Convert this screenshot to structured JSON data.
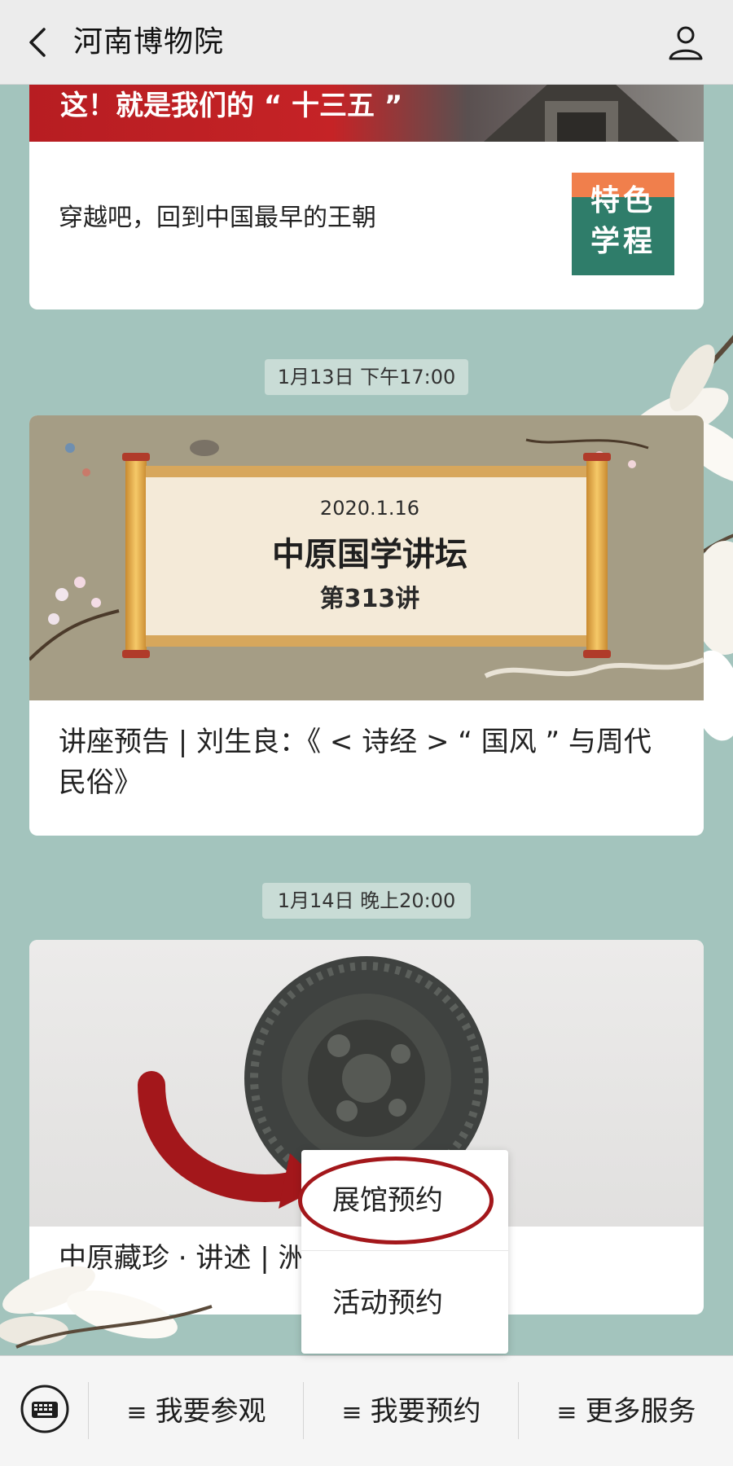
{
  "header": {
    "title": "河南博物院",
    "back_icon": "chevron-left-icon",
    "profile_icon": "person-icon"
  },
  "feed": {
    "card1": {
      "banner_text": "这！就是我们的 “ 十三五 ”",
      "title": "穿越吧，回到中国最早的王朝",
      "thumb_line1": "特色",
      "thumb_line2": "学程"
    },
    "timestamp1": "1月13日 下午17:00",
    "card2": {
      "scroll_date": "2020.1.16",
      "scroll_title": "中原国学讲坛",
      "scroll_sub": "第313讲",
      "title": "讲座预告 | 刘生良：《 < 诗经 > “ 国风 ” 与周代民俗》"
    },
    "timestamp2": "1月14日 晚上20:00",
    "card3": {
      "title": "中原藏珍 · 讲述 | 洲"
    }
  },
  "popup": {
    "items": [
      "展馆预约",
      "活动预约"
    ],
    "highlight_color": "#a3171b"
  },
  "bottom_bar": {
    "keyboard_icon": "keyboard-icon",
    "menu_glyph": "≡",
    "items": [
      "我要参观",
      "我要预约",
      "更多服务"
    ]
  },
  "colors": {
    "background": "#a3c4bd",
    "header": "#ececec",
    "accent_red": "#b71d22"
  }
}
